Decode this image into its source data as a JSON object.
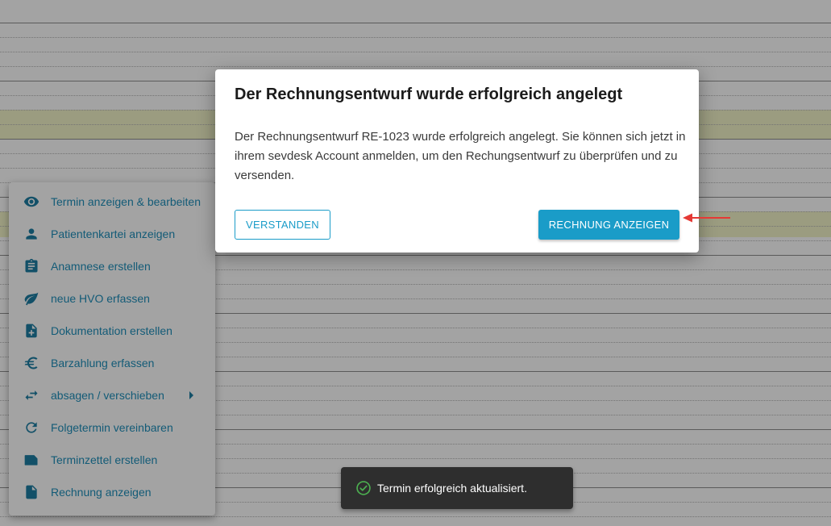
{
  "colors": {
    "accent": "#1a9cc8",
    "menu_icon": "#1d7da3",
    "highlight_row": "#f3f5c8",
    "annotation_arrow": "#e53935",
    "snackbar_bg": "#2e2e2e",
    "success": "#4caf50"
  },
  "context_menu": {
    "items": [
      {
        "label": "Termin anzeigen & bearbeiten",
        "icon": "eye-icon"
      },
      {
        "label": "Patientenkartei anzeigen",
        "icon": "person-icon"
      },
      {
        "label": "Anamnese erstellen",
        "icon": "clipboard-icon"
      },
      {
        "label": "neue HVO erfassen",
        "icon": "leaf-icon"
      },
      {
        "label": "Dokumentation erstellen",
        "icon": "add-document-icon"
      },
      {
        "label": "Barzahlung erfassen",
        "icon": "euro-icon"
      },
      {
        "label": "absagen / verschieben",
        "icon": "swap-arrows-icon",
        "has_submenu": true
      },
      {
        "label": "Folgetermin vereinbaren",
        "icon": "refresh-icon"
      },
      {
        "label": "Terminzettel erstellen",
        "icon": "folded-card-icon"
      },
      {
        "label": "Rechnung anzeigen",
        "icon": "document-icon"
      }
    ]
  },
  "dialog": {
    "title": "Der Rechnungsentwurf wurde erfolgreich angelegt",
    "body": "Der Rechnungsentwurf RE-1023 wurde erfolgreich angelegt. Sie können sich jetzt in ihrem sevdesk Account anmelden, um den Rechungsentwurf zu überprüfen und zu versenden.",
    "secondary_button": "VERSTANDEN",
    "primary_button": "RECHNUNG ANZEIGEN"
  },
  "snackbar": {
    "message": "Termin erfolgreich aktualisiert.",
    "icon": "check-circle-icon"
  }
}
